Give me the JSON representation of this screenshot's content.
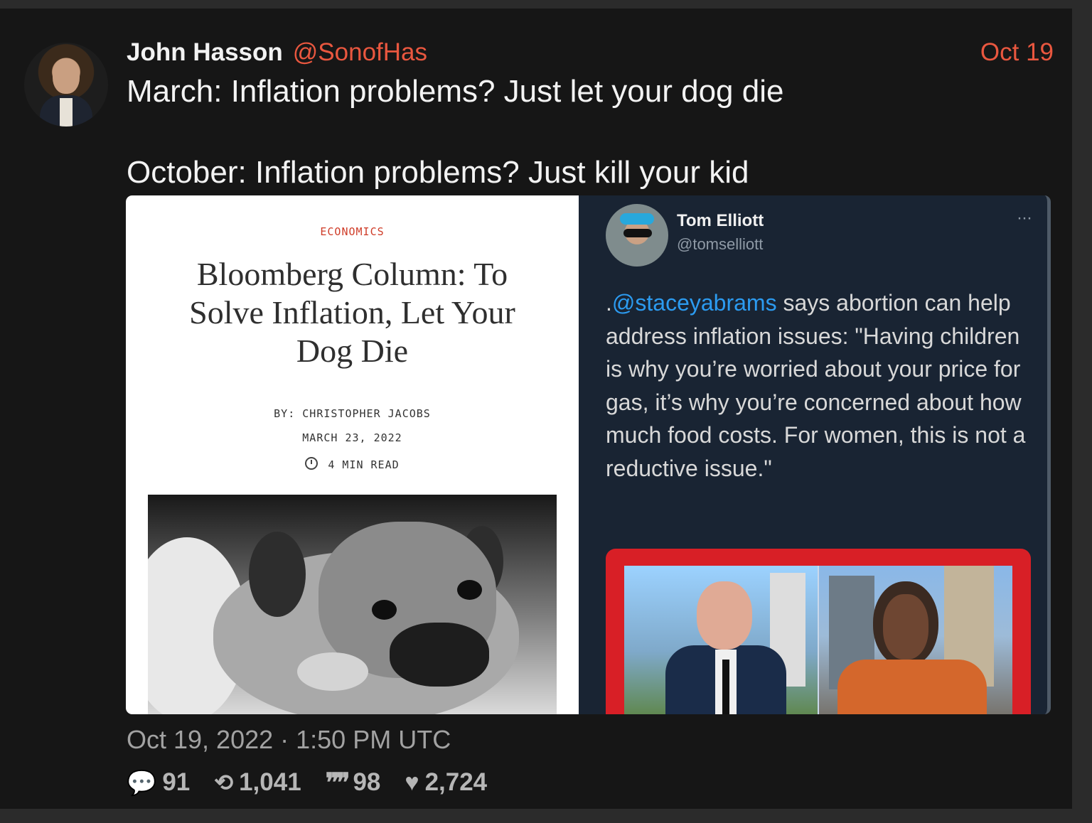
{
  "tweet": {
    "author_name": "John Hasson",
    "author_handle": "@SonofHas",
    "date_short": "Oct 19",
    "line1": "March: Inflation problems? Just let your dog die",
    "line2": "October: Inflation problems? Just kill your kid",
    "timestamp": "Oct 19, 2022 · 1:50 PM UTC",
    "stats": {
      "replies": "91",
      "retweets": "1,041",
      "quotes": "98",
      "likes": "2,724"
    }
  },
  "left_image": {
    "category": "ECONOMICS",
    "title": "Bloomberg Column: To Solve Inflation, Let Your Dog Die",
    "byline": "BY: CHRISTOPHER JACOBS",
    "date": "MARCH 23, 2022",
    "read_time": "4 MIN READ"
  },
  "right_image": {
    "name": "Tom Elliott",
    "handle": "@tomselliott",
    "more": "···",
    "prefix": ".",
    "mention": "@staceyabrams",
    "text": " says abortion can help address inflation issues: \"Having children is why you’re worried about your price for gas, it’s why you’re concerned about how much food costs. For women, this is not a reductive issue.\""
  },
  "icons": {
    "reply": "speech-bubble-icon",
    "retweet": "retweet-icon",
    "quote": "quote-icon",
    "like": "heart-icon"
  }
}
